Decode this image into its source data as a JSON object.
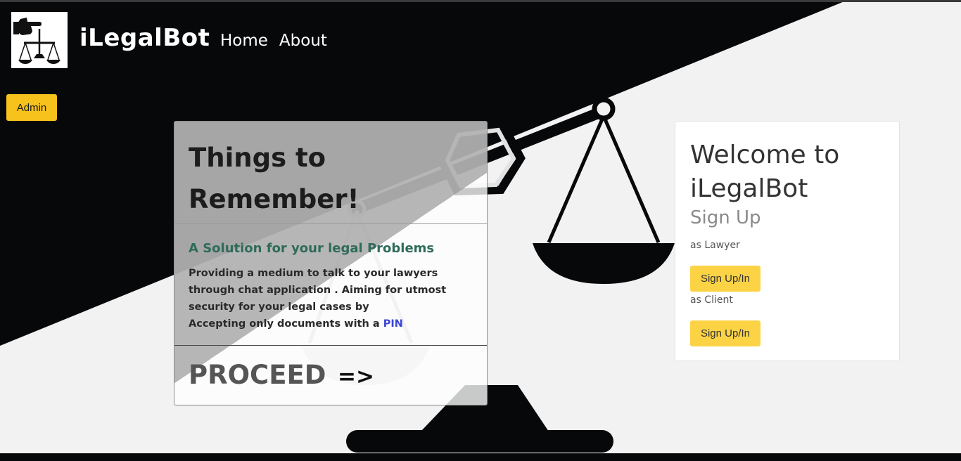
{
  "header": {
    "brand": "iLegalBot",
    "nav": [
      "Home",
      "About"
    ],
    "logo_icon": "pointing-hand-scales-icon"
  },
  "admin": {
    "label": "Admin"
  },
  "things_card": {
    "title": "Things to Remember!",
    "subtitle": "A Solution for your legal Problems",
    "text": "Providing a medium to talk to your lawyers through chat application . Aiming for utmost security for your legal cases by",
    "text2": "Accepting only documents with a",
    "pin": "PIN",
    "proceed": "PROCEED",
    "arrow": "=>"
  },
  "welcome_card": {
    "title": "Welcome to iLegalBot",
    "signup": "Sign Up",
    "as_lawyer": "as Lawyer",
    "lawyer_button": "Sign Up/In",
    "as_client": "as Client",
    "client_button": "Sign Up/In"
  },
  "colors": {
    "admin_button": "#f7c21c",
    "signup_button": "#fbd345",
    "subtitle": "#2f6b5a",
    "pin": "#3b45d8",
    "background_dark": "#07080a"
  }
}
